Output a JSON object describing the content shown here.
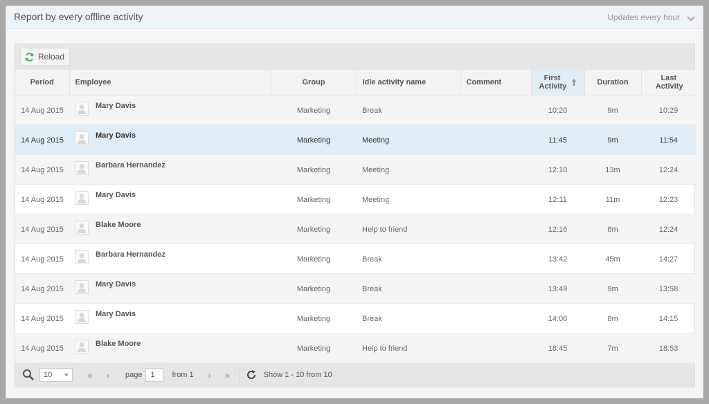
{
  "panel": {
    "title": "Report by every offline activity",
    "updates": "Updates every hour"
  },
  "toolbar": {
    "reload_label": "Reload"
  },
  "columns": [
    "Period",
    "Employee",
    "Group",
    "Idle activity name",
    "Comment",
    "First Activity",
    "Duration",
    "Last Activity"
  ],
  "rows": [
    {
      "period": "14 Aug 2015",
      "employee": "Mary Davis",
      "group": "Marketing",
      "activity": "Break",
      "comment": "",
      "first": "10:20",
      "duration": "9m",
      "last": "10:29"
    },
    {
      "period": "14 Aug 2015",
      "employee": "Mary Davis",
      "group": "Marketing",
      "activity": "Meeting",
      "comment": "",
      "first": "11:45",
      "duration": "9m",
      "last": "11:54"
    },
    {
      "period": "14 Aug 2015",
      "employee": "Barbara Hernandez",
      "group": "Marketing",
      "activity": "Meeting",
      "comment": "",
      "first": "12:10",
      "duration": "13m",
      "last": "12:24"
    },
    {
      "period": "14 Aug 2015",
      "employee": "Mary Davis",
      "group": "Marketing",
      "activity": "Meeting",
      "comment": "",
      "first": "12:11",
      "duration": "11m",
      "last": "12:23"
    },
    {
      "period": "14 Aug 2015",
      "employee": "Blake Moore",
      "group": "Marketing",
      "activity": "Help to friend",
      "comment": "",
      "first": "12:16",
      "duration": "8m",
      "last": "12:24"
    },
    {
      "period": "14 Aug 2015",
      "employee": "Barbara Hernandez",
      "group": "Marketing",
      "activity": "Break",
      "comment": "",
      "first": "13:42",
      "duration": "45m",
      "last": "14:27"
    },
    {
      "period": "14 Aug 2015",
      "employee": "Mary Davis",
      "group": "Marketing",
      "activity": "Break",
      "comment": "",
      "first": "13:49",
      "duration": "9m",
      "last": "13:58"
    },
    {
      "period": "14 Aug 2015",
      "employee": "Mary Davis",
      "group": "Marketing",
      "activity": "Break",
      "comment": "",
      "first": "14:06",
      "duration": "8m",
      "last": "14:15"
    },
    {
      "period": "14 Aug 2015",
      "employee": "Blake Moore",
      "group": "Marketing",
      "activity": "Help to friend",
      "comment": "",
      "first": "18:45",
      "duration": "7m",
      "last": "18:53"
    }
  ],
  "footer": {
    "page_size": "10",
    "page_label": "page",
    "page_value": "1",
    "from_label": "from 1",
    "show_label": "Show 1 - 10 from 10"
  }
}
